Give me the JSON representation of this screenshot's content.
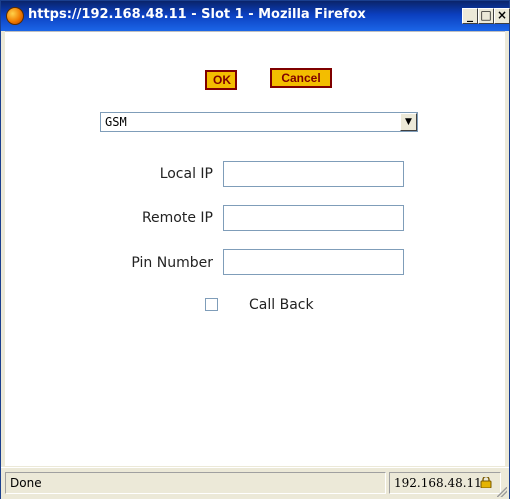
{
  "window": {
    "title": "https://192.168.48.11 - Slot 1 - Mozilla Firefox",
    "icon": "firefox-icon"
  },
  "buttons": {
    "ok": "OK",
    "cancel": "Cancel"
  },
  "connection_type": {
    "selected": "GSM"
  },
  "fields": {
    "local_ip": {
      "label": "Local IP",
      "value": ""
    },
    "remote_ip": {
      "label": "Remote IP",
      "value": ""
    },
    "pin_number": {
      "label": "Pin Number",
      "value": ""
    }
  },
  "callback": {
    "label": "Call Back",
    "checked": false
  },
  "status": {
    "left": "Done",
    "right": "192.168.48.11",
    "icon": "lock-icon"
  },
  "colors": {
    "titlebar": "#0b3fbf",
    "button_fill": "#f3bd00",
    "button_border": "#7f0000"
  }
}
